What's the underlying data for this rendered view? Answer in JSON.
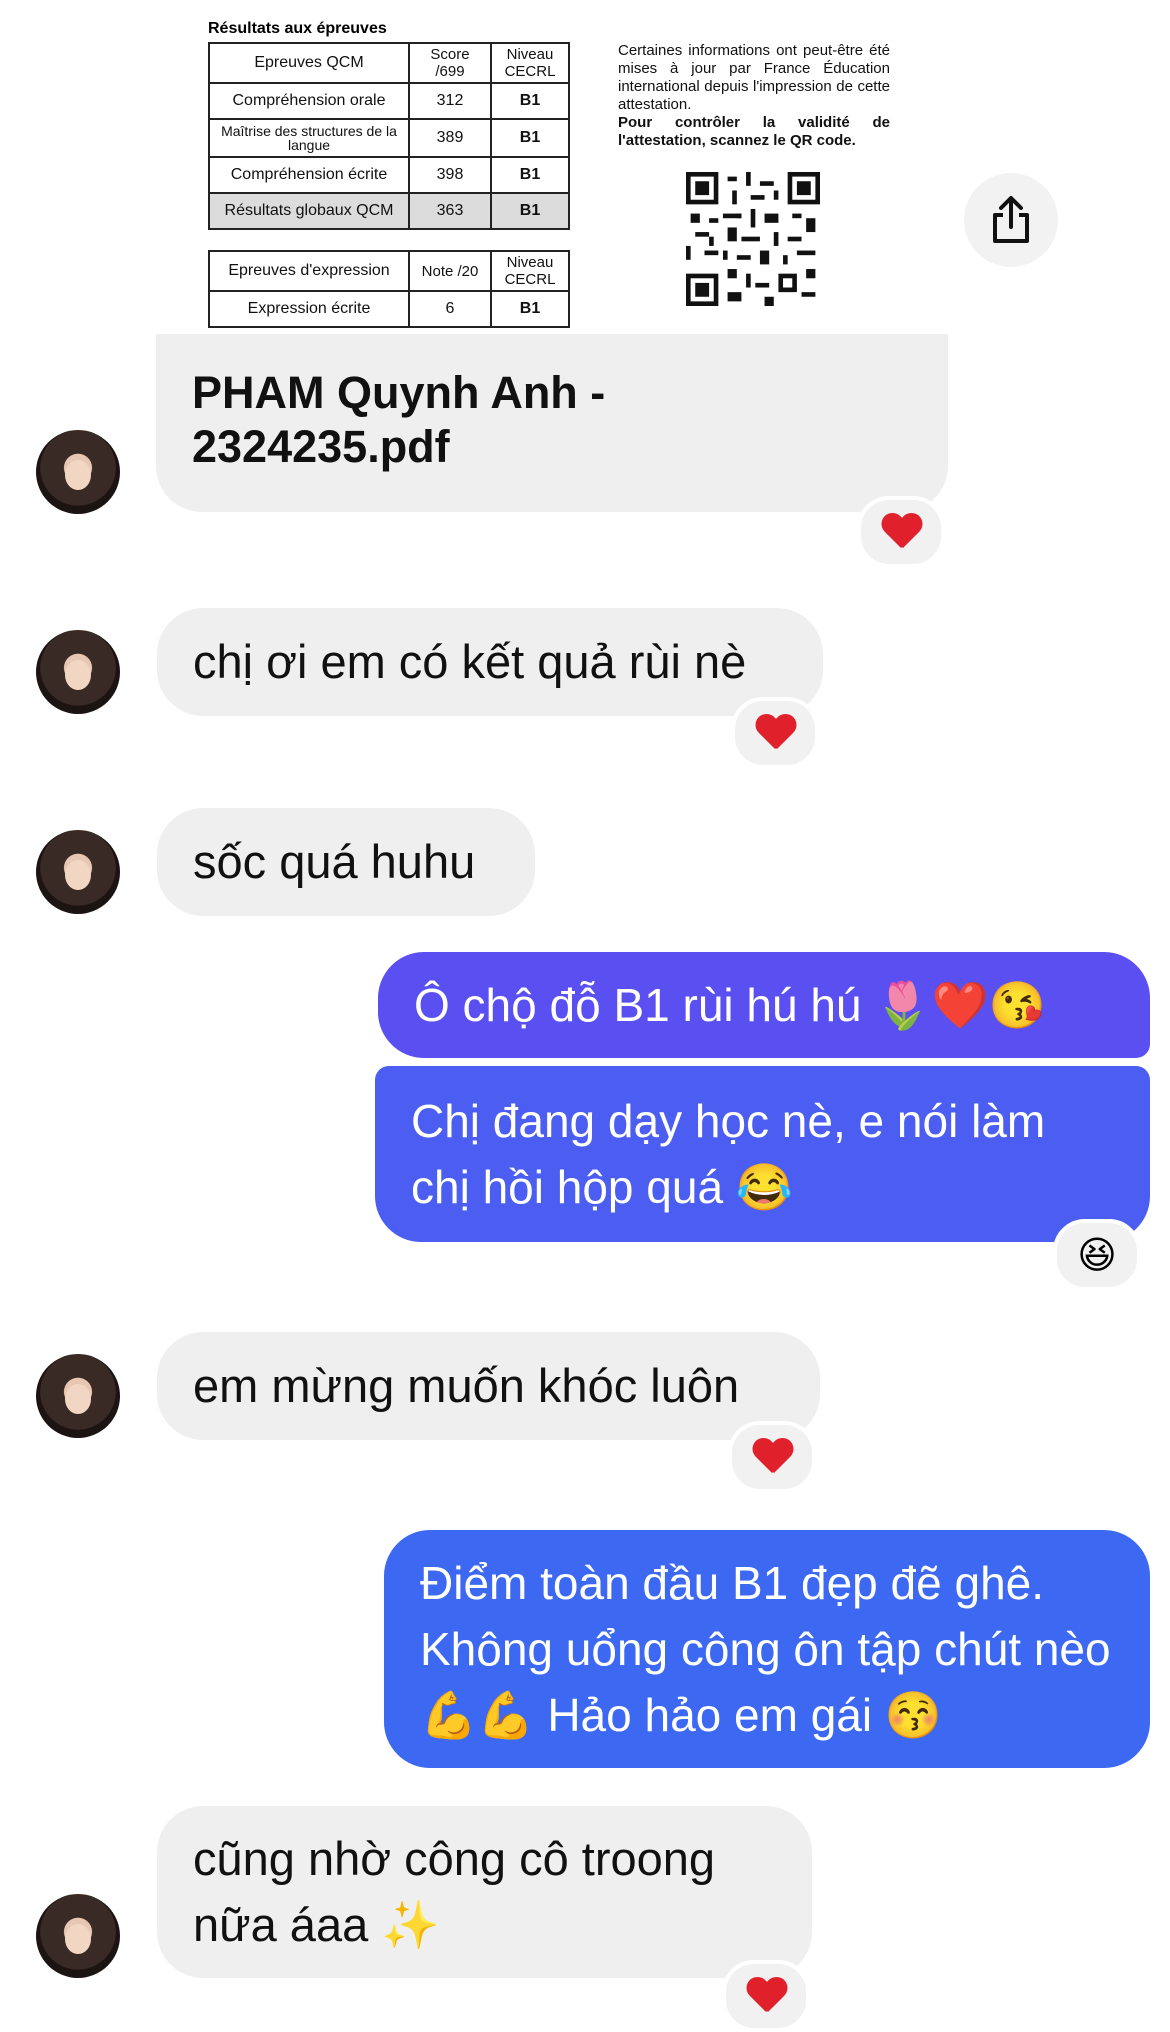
{
  "attachment": {
    "heading": "Résultats aux épreuves",
    "qcm_table": {
      "headers": [
        "Epreuves QCM",
        "Score /699",
        "Niveau CECRL"
      ],
      "rows": [
        [
          "Compréhension orale",
          "312",
          "B1"
        ],
        [
          "Maîtrise des structures de la langue",
          "389",
          "B1"
        ],
        [
          "Compréhension écrite",
          "398",
          "B1"
        ],
        [
          "Résultats globaux QCM",
          "363",
          "B1"
        ]
      ]
    },
    "expression_table": {
      "headers": [
        "Epreuves d'expression",
        "Note /20",
        "Niveau CECRL"
      ],
      "rows": [
        [
          "Expression écrite",
          "6",
          "B1"
        ]
      ]
    },
    "notice_line1": "Certaines informations ont peut-être été mises à jour par France Éducation international depuis l'impression de cette attestation.",
    "notice_line2": "Pour contrôler la validité de l'attestation, scannez le QR code.",
    "filename": "PHAM Quynh Anh - 2324235.pdf",
    "share_icon": "share-icon"
  },
  "messages": [
    {
      "side": "in",
      "text": "chị ơi em có kết quả rùi nè",
      "reaction": "heart"
    },
    {
      "side": "in",
      "text": "sốc quá huhu"
    },
    {
      "side": "out",
      "text": "Ô chộ đỗ B1 rùi hú hú 🌷❤️😘"
    },
    {
      "side": "out",
      "text": "Chị đang dạy học nè, e nói làm chị hồi hộp quá 😂",
      "reaction": "😆"
    },
    {
      "side": "in",
      "text": "em mừng muốn khóc luôn",
      "reaction": "heart"
    },
    {
      "side": "out",
      "text": "Điểm toàn đầu B1 đẹp đẽ ghê. Không uổng công ôn tập chút nèo 💪💪 Hảo hảo em gái 😚"
    },
    {
      "side": "in",
      "text": "cũng nhờ công cô troong nữa áaa ✨",
      "reaction": "heart"
    }
  ],
  "colors": {
    "incoming_bubble": "#efefef",
    "outgoing_top": "#5b4ef0",
    "outgoing_bottom": "#3c6af2",
    "heart": "#e0202a"
  }
}
